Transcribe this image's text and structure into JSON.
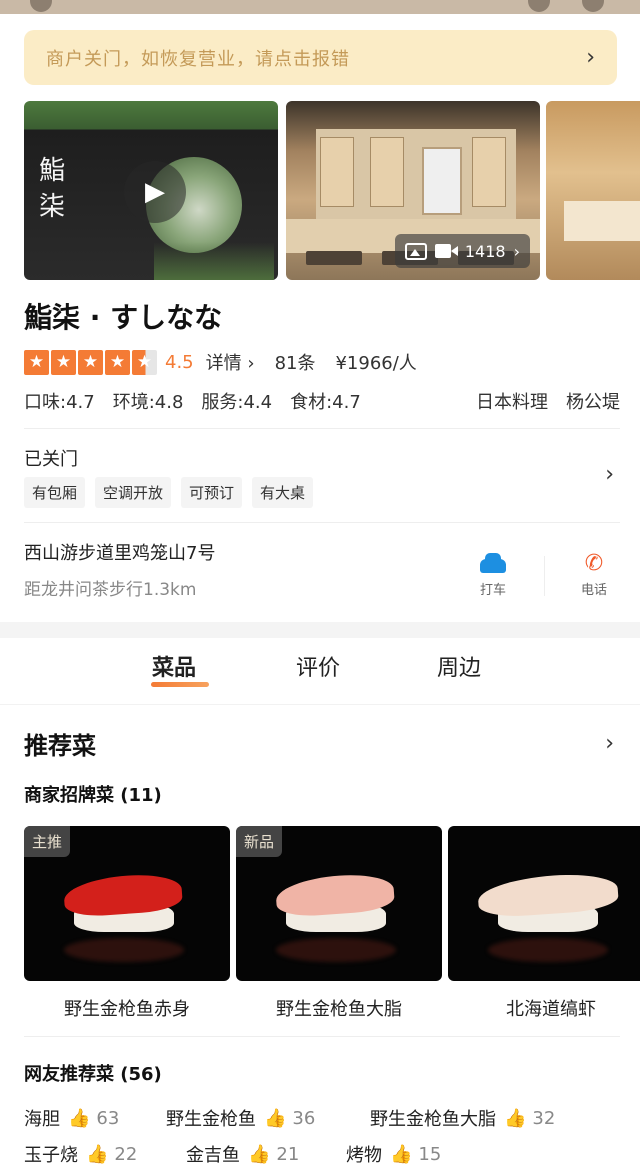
{
  "notice": {
    "text": "商户关门，如恢复营业，请点击报错"
  },
  "gallery": {
    "photo_count": "1418"
  },
  "shop": {
    "name": "鮨柒 · すしなな",
    "rating": 4.5,
    "score": "4.5",
    "detail_link": "详情",
    "review_count": "81条",
    "price": "¥1966/人",
    "sub_scores": [
      "口味:4.7",
      "环境:4.8",
      "服务:4.4",
      "食材:4.7"
    ],
    "category": "日本料理",
    "area": "杨公堤",
    "status": "已关门",
    "tags": [
      "有包厢",
      "空调开放",
      "可预订",
      "有大桌"
    ],
    "address": "西山游步道里鸡笼山7号",
    "distance": "距龙井问茶步行1.3km",
    "actions": {
      "taxi": "打车",
      "call": "电话"
    }
  },
  "photo_sign": {
    "text_line1": "鮨",
    "text_line2": "柒"
  },
  "tabs": [
    "菜品",
    "评价",
    "周边"
  ],
  "recommend": {
    "title": "推荐菜",
    "signature_title": "商家招牌菜 (11)",
    "signature": [
      {
        "badge": "主推",
        "name": "野生金枪鱼赤身"
      },
      {
        "badge": "新品",
        "name": "野生金枪鱼大脂"
      },
      {
        "badge": "",
        "name": "北海道缟虾"
      }
    ],
    "netizen_title": "网友推荐菜 (56)",
    "netizen_rows": [
      [
        {
          "name": "海胆",
          "count": "63"
        },
        {
          "name": "野生金枪鱼",
          "count": "36"
        },
        {
          "name": "野生金枪鱼大脂",
          "count": "32"
        }
      ],
      [
        {
          "name": "玉子烧",
          "count": "22"
        },
        {
          "name": "金吉鱼",
          "count": "21"
        },
        {
          "name": "烤物",
          "count": "15"
        }
      ]
    ]
  },
  "icons": {
    "star": "star-icon",
    "thumb": "thumbs-up-icon",
    "car": "car-icon",
    "phone": "phone-icon",
    "play": "play-icon"
  },
  "colors": {
    "accent": "#f47b35",
    "notice_bg": "#fbecc6",
    "notice_text": "#c49a58",
    "taxi": "#1d8fe1",
    "call": "#f05a2a"
  }
}
